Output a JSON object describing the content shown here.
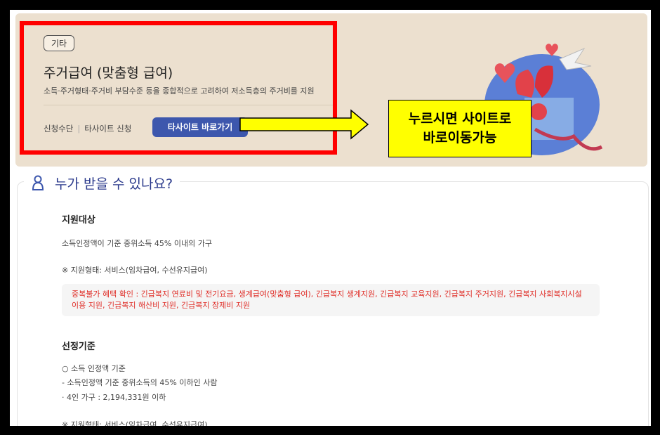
{
  "banner": {
    "tag": "기타",
    "title": "주거급여 (맞춤형 급여)",
    "description": "소득·주거형태·주거비 부담수준 등을 종합적으로 고려하여 저소득층의 주거비를 지원",
    "method_label": "신청수단",
    "method_value": "타사이트 신청",
    "site_button": "타사이트 바로가기"
  },
  "callout": {
    "line1": "누르시면 사이트로",
    "line2": "바로이동가능"
  },
  "section": {
    "heading": "누가 받을 수 있나요?",
    "target_title": "지원대상",
    "target_text": "소득인정액이 기준 중위소득 45% 이내의 가구",
    "support_type": "※ 지원형태: 서비스(임차급여, 수선유지급여)",
    "duplicate_notice": "중복불가 혜택 확인 : 긴급복지 연료비 및 전기요금, 생계급여(맞춤형 급여), 긴급복지 생계지원, 긴급복지 교육지원, 긴급복지 주거지원, 긴급복지 사회복지시설 이용 지원, 긴급복지 해산비 지원, 긴급복지 장제비 지원",
    "criteria_title": "선정기준",
    "criteria_lines": [
      "○ 소득 인정액 기준",
      "- 소득인정액 기준 중위소득의 45% 이하인 사람",
      "· 4인 가구 : 2,194,331원 이하",
      "※ 지원형태: 서비스(임차급여, 수선유지급여)"
    ]
  },
  "colors": {
    "banner_bg": "#ece0cf",
    "button_bg": "#3d57ad",
    "highlight_red": "#ff0000",
    "callout_yellow": "#ffff00",
    "notice_red": "#e0302a",
    "heading_navy": "#2b3a8c"
  }
}
